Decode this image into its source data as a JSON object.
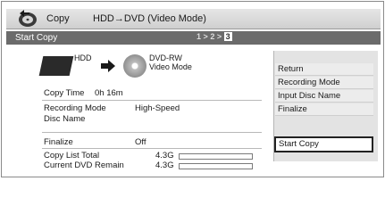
{
  "header": {
    "icon": "disc-copy-icon",
    "title": "Copy",
    "subtitle": "HDD→DVD (Video Mode)"
  },
  "stepbar": {
    "label": "Start Copy",
    "steps": [
      "1",
      "2",
      "3"
    ],
    "current_step": "3"
  },
  "diagram": {
    "source": "HDD",
    "destination_line1": "DVD-RW",
    "destination_line2": "Video Mode"
  },
  "info": {
    "copy_time_label": "Copy Time",
    "copy_time_value": "0h 16m",
    "recording_mode_label": "Recording Mode",
    "recording_mode_value": "High-Speed",
    "disc_name_label": "Disc Name",
    "disc_name_value": "",
    "finalize_label": "Finalize",
    "finalize_value": "Off",
    "copy_list_total_label": "Copy List Total",
    "copy_list_total_value": "4.3G",
    "copy_list_total_fill": 0.0,
    "dvd_remain_label": "Current DVD Remain",
    "dvd_remain_value": "4.3G",
    "dvd_remain_fill": 0.0
  },
  "menu": {
    "items": [
      "Return",
      "Recording Mode",
      "Input Disc Name",
      "Finalize"
    ],
    "primary": "Start Copy"
  }
}
